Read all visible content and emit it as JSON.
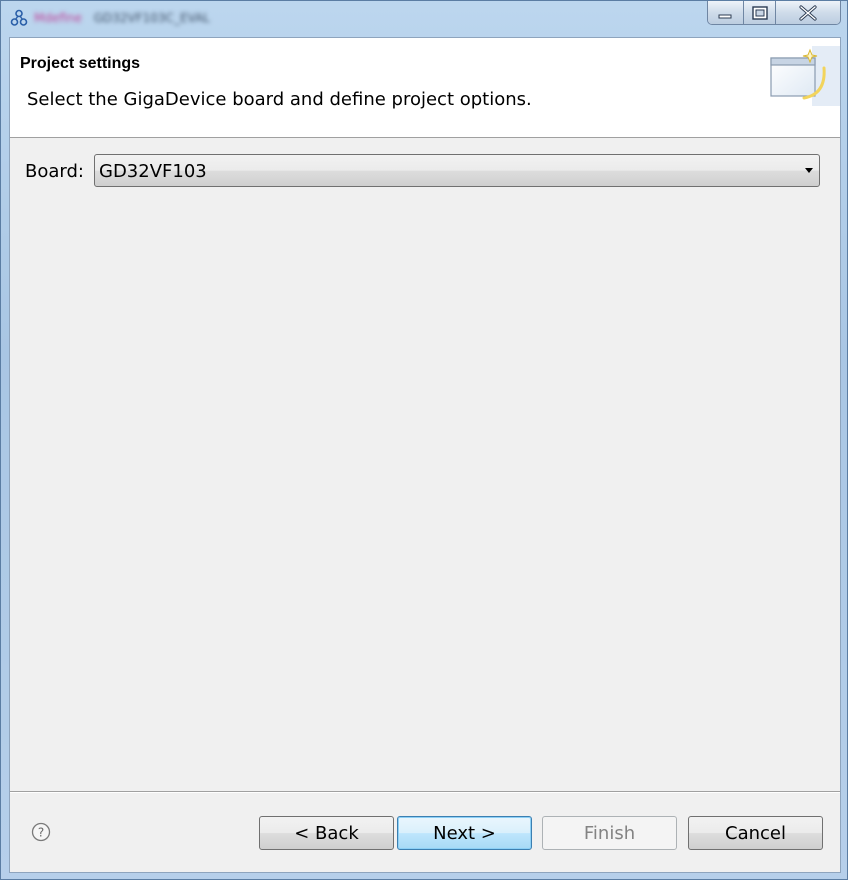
{
  "window": {
    "title_app": "Mdefine",
    "title_project": "GD32VF103C_EVAL"
  },
  "header": {
    "title": "Project settings",
    "description": "Select the GigaDevice board and define project options."
  },
  "form": {
    "board_label": "Board:",
    "board_value": "GD32VF103"
  },
  "footer": {
    "back_label": "< Back",
    "next_label": "Next >",
    "finish_label": "Finish",
    "cancel_label": "Cancel"
  },
  "icons": {
    "app": "app-icon",
    "minimize": "minimize-icon",
    "maximize": "maximize-icon",
    "close": "close-icon",
    "wizard": "wizard-banner-icon",
    "help": "help-icon",
    "dropdown": "chevron-down-icon"
  },
  "colors": {
    "next_button_border": "#3c7fb1",
    "disabled_text": "#838383"
  }
}
